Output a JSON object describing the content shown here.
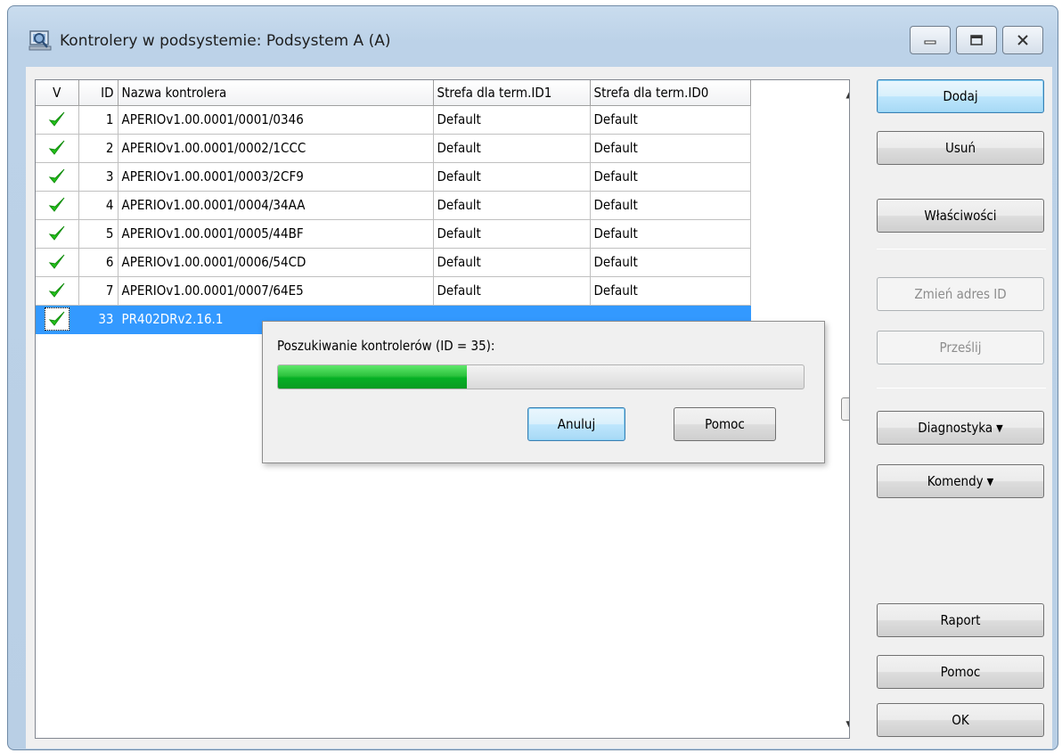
{
  "window": {
    "title": "Kontrolery w podsystemie: Podsystem A (A)",
    "controls": [
      "minimize-icon",
      "maximize-icon",
      "close-icon"
    ]
  },
  "table": {
    "columns": [
      "V",
      "ID",
      "Nazwa kontrolera",
      "Strefa dla term.ID1",
      "Strefa dla term.ID0"
    ],
    "rows": [
      {
        "checked": true,
        "id": "1",
        "name": "APERIOv1.00.0001/0001/0346",
        "zone1": "Default",
        "zone0": "Default"
      },
      {
        "checked": true,
        "id": "2",
        "name": "APERIOv1.00.0001/0002/1CCC",
        "zone1": "Default",
        "zone0": "Default"
      },
      {
        "checked": true,
        "id": "3",
        "name": "APERIOv1.00.0001/0003/2CF9",
        "zone1": "Default",
        "zone0": "Default"
      },
      {
        "checked": true,
        "id": "4",
        "name": "APERIOv1.00.0001/0004/34AA",
        "zone1": "Default",
        "zone0": "Default"
      },
      {
        "checked": true,
        "id": "5",
        "name": "APERIOv1.00.0001/0005/44BF",
        "zone1": "Default",
        "zone0": "Default"
      },
      {
        "checked": true,
        "id": "6",
        "name": "APERIOv1.00.0001/0006/54CD",
        "zone1": "Default",
        "zone0": "Default"
      },
      {
        "checked": true,
        "id": "7",
        "name": "APERIOv1.00.0001/0007/64E5",
        "zone1": "Default",
        "zone0": "Default"
      },
      {
        "checked": true,
        "id": "33",
        "name": "PR402DRv2.16.1",
        "zone1": "",
        "zone0": "",
        "selected": true
      }
    ]
  },
  "buttons": {
    "add": "Dodaj",
    "remove": "Usuń",
    "properties": "Właściwości",
    "change_id": "Zmień adres ID",
    "send": "Prześlij",
    "diagnostics": "Diagnostyka",
    "commands": "Komendy",
    "report": "Raport",
    "help": "Pomoc",
    "ok": "OK"
  },
  "progress_dialog": {
    "label": "Poszukiwanie kontrolerów (ID = 35):",
    "progress": 0.36,
    "cancel": "Anuluj",
    "help": "Pomoc"
  },
  "colors": {
    "selection": "#3399ff",
    "check": "#22c11a",
    "progress": "#06b025"
  }
}
